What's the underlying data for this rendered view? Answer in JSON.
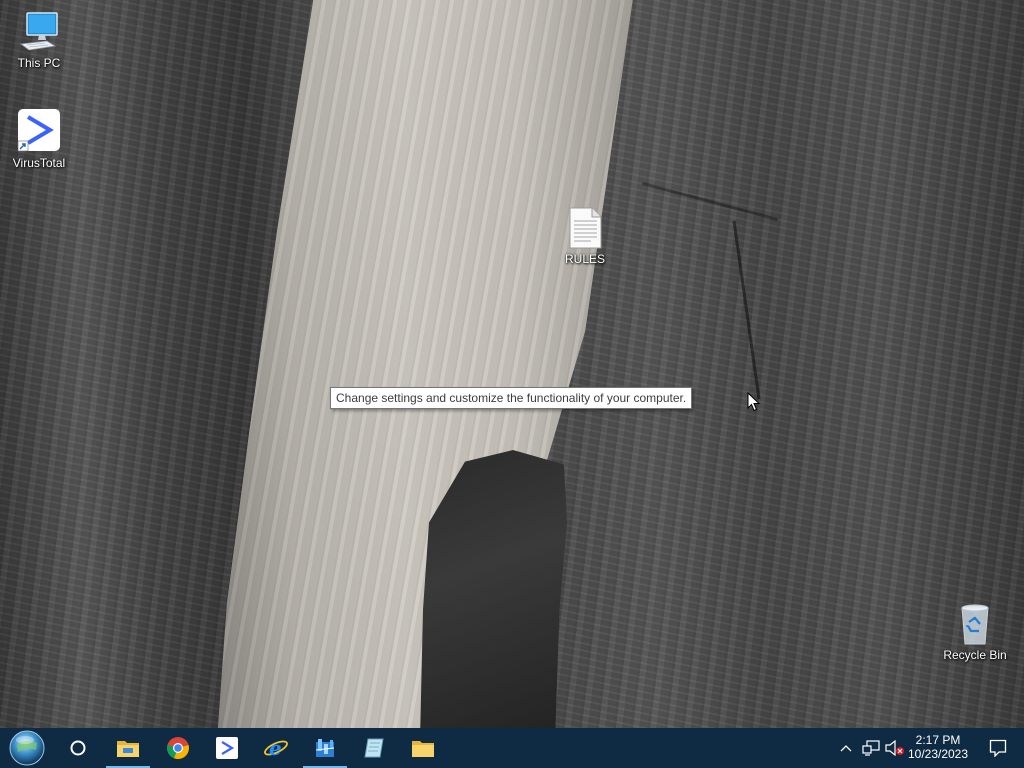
{
  "desktop": {
    "icons": [
      {
        "label": "This PC",
        "icon": "this-pc-icon"
      },
      {
        "label": "VirusTotal",
        "icon": "virustotal-icon"
      },
      {
        "label": "RULES",
        "icon": "text-document-icon"
      },
      {
        "label": "Recycle Bin",
        "icon": "recycle-bin-icon"
      }
    ],
    "tooltip": "Change settings and customize the functionality of your computer."
  },
  "taskbar": {
    "start": "start-orb-icon",
    "search": "cortana-search-icon",
    "apps": [
      {
        "icon": "file-explorer-icon",
        "active": true
      },
      {
        "icon": "chrome-icon",
        "active": false
      },
      {
        "icon": "virustotal-icon",
        "active": false
      },
      {
        "icon": "internet-explorer-icon",
        "active": false
      },
      {
        "icon": "control-panel-icon",
        "active": true
      },
      {
        "icon": "notepad-book-icon",
        "active": false
      },
      {
        "icon": "folder-icon",
        "active": false
      }
    ],
    "tray": {
      "icons": [
        "chevron-up-icon",
        "network-icon",
        "volume-muted-icon"
      ],
      "time": "2:17 PM",
      "date": "10/23/2023",
      "notification": "action-center-icon"
    }
  },
  "colors": {
    "taskbar_bg": "#0f2a43",
    "active_indicator": "#76b9ed",
    "tooltip_border": "#767676"
  }
}
